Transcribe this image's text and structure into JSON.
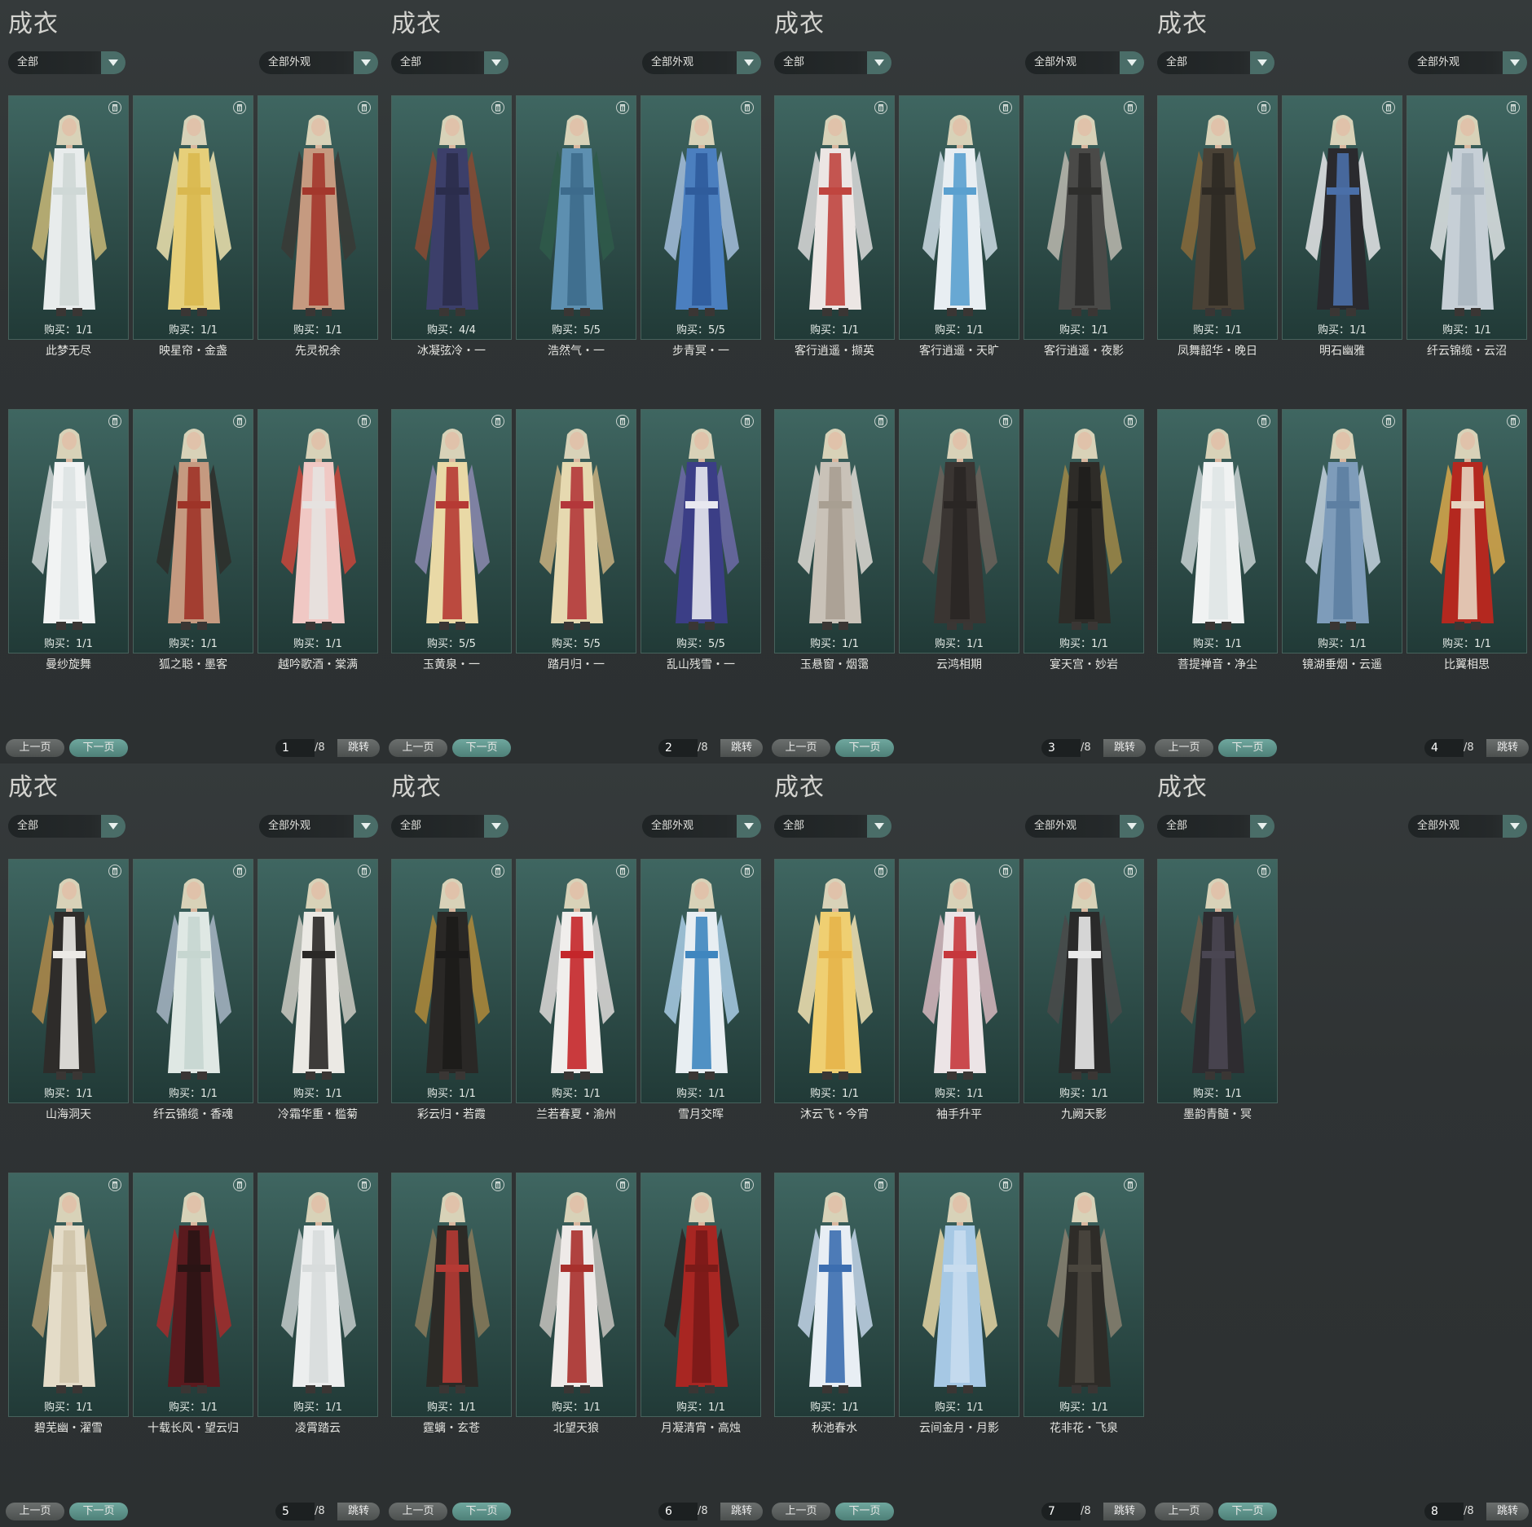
{
  "panels": [
    {
      "title": "成衣",
      "filter1": "全部",
      "filter2": "全部外观",
      "prev": "上一页",
      "next": "下一页",
      "page": "1",
      "total": "/8",
      "jump": "跳转",
      "items": [
        {
          "buy": "购买：1/1",
          "name": "此梦无尽",
          "colors": [
            "#e8ecec",
            "#cfd8d6",
            "#c9b978"
          ]
        },
        {
          "buy": "购买：1/1",
          "name": "映星帘・金盏",
          "colors": [
            "#e6cf7a",
            "#d9b84f",
            "#f0e4b0"
          ]
        },
        {
          "buy": "购买：1/1",
          "name": "先灵祝余",
          "colors": [
            "#c59a80",
            "#a3372c",
            "#3a3a36"
          ]
        },
        {
          "buy": "购买：1/1",
          "name": "曼纱旋舞",
          "colors": [
            "#f1f3f3",
            "#dde3e3",
            "#cfd6d6"
          ]
        },
        {
          "buy": "购买：1/1",
          "name": "狐之聪・墨客",
          "colors": [
            "#c59a80",
            "#9e3428",
            "#2e2e2a"
          ]
        },
        {
          "buy": "购买：1/1",
          "name": "越吟歌酒・棠满",
          "colors": [
            "#f0c8c4",
            "#e6e2e0",
            "#c9453b"
          ]
        }
      ]
    },
    {
      "title": "成衣",
      "filter1": "全部",
      "filter2": "全部外观",
      "prev": "上一页",
      "next": "下一页",
      "page": "2",
      "total": "/8",
      "jump": "跳转",
      "items": [
        {
          "buy": "购买：4/4",
          "name": "冰凝弦冷・一",
          "colors": [
            "#3c3f6a",
            "#2b2d4c",
            "#8a4a32"
          ]
        },
        {
          "buy": "购买：5/5",
          "name": "浩然气・一",
          "colors": [
            "#5d8fb0",
            "#3d6b8c",
            "#2f5b4a"
          ]
        },
        {
          "buy": "购买：5/5",
          "name": "步青冥・一",
          "colors": [
            "#4b7fbf",
            "#2f5c9c",
            "#a6c0de"
          ]
        },
        {
          "buy": "购买：5/5",
          "name": "玉黄泉・一",
          "colors": [
            "#e9d9a6",
            "#b63a34",
            "#8c8ab0"
          ]
        },
        {
          "buy": "购买：5/5",
          "name": "踏月归・一",
          "colors": [
            "#e6d9b0",
            "#b3373a",
            "#c9b080"
          ]
        },
        {
          "buy": "购买：5/5",
          "name": "乱山残雪・一",
          "colors": [
            "#3b3e86",
            "#e8e8f0",
            "#6d6aa8"
          ]
        }
      ]
    },
    {
      "title": "成衣",
      "filter1": "全部",
      "filter2": "全部外观",
      "prev": "上一页",
      "next": "下一页",
      "page": "3",
      "total": "/8",
      "jump": "跳转",
      "items": [
        {
          "buy": "购买：1/1",
          "name": "客行逍遥・撷英",
          "colors": [
            "#ece6e4",
            "#c0453f",
            "#dddcdc"
          ]
        },
        {
          "buy": "购买：1/1",
          "name": "客行逍遥・天旷",
          "colors": [
            "#e8eef2",
            "#5aa0cf",
            "#cfdde6"
          ]
        },
        {
          "buy": "购买：1/1",
          "name": "客行逍遥・夜影",
          "colors": [
            "#4a4a48",
            "#2e2e2c",
            "#bdbab0"
          ]
        },
        {
          "buy": "购买：1/1",
          "name": "玉悬窗・烟霭",
          "colors": [
            "#c9c2b8",
            "#a89f92",
            "#e0dcd6"
          ]
        },
        {
          "buy": "购买：1/1",
          "name": "云鸿相期",
          "colors": [
            "#3a3532",
            "#2a2624",
            "#6b625a"
          ]
        },
        {
          "buy": "购买：1/1",
          "name": "宴天宫・妙岩",
          "colors": [
            "#2e2c28",
            "#1f1e1c",
            "#a08848"
          ]
        }
      ]
    },
    {
      "title": "成衣",
      "filter1": "全部",
      "filter2": "全部外观",
      "prev": "上一页",
      "next": "下一页",
      "page": "4",
      "total": "/8",
      "jump": "跳转",
      "items": [
        {
          "buy": "购买：1/1",
          "name": "凤舞韶华・晚日",
          "colors": [
            "#4a4236",
            "#2e2a24",
            "#8a6a3a"
          ]
        },
        {
          "buy": "购买：1/1",
          "name": "明石幽雅",
          "colors": [
            "#2a2a2e",
            "#4a6fa8",
            "#e8e8ea"
          ]
        },
        {
          "buy": "购买：1/1",
          "name": "纤云锦缆・云沼",
          "colors": [
            "#c6cfd6",
            "#aab6c0",
            "#e2e6e8"
          ]
        },
        {
          "buy": "购买：1/1",
          "name": "菩提禅音・净尘",
          "colors": [
            "#f0f2f2",
            "#dfe5e6",
            "#c9d2d4"
          ]
        },
        {
          "buy": "购买：1/1",
          "name": "镜湖垂烟・云遥",
          "colors": [
            "#7e9cba",
            "#5d7fa2",
            "#c6d4e0"
          ]
        },
        {
          "buy": "购买：1/1",
          "name": "比翼相思",
          "colors": [
            "#b4281f",
            "#e6d4c0",
            "#d9a84a"
          ]
        }
      ]
    },
    {
      "title": "成衣",
      "filter1": "全部",
      "filter2": "全部外观",
      "prev": "上一页",
      "next": "下一页",
      "page": "5",
      "total": "/8",
      "jump": "跳转",
      "items": [
        {
          "buy": "购买：1/1",
          "name": "山海洞天",
          "colors": [
            "#2e2c2a",
            "#eceae6",
            "#b08a4a"
          ]
        },
        {
          "buy": "购买：1/1",
          "name": "纤云锦缆・香魂",
          "colors": [
            "#dfe8e4",
            "#c6d6d0",
            "#a8b6c6"
          ]
        },
        {
          "buy": "购买：1/1",
          "name": "冷霜华重・槛菊",
          "colors": [
            "#ebe9e4",
            "#2a2826",
            "#cfccc4"
          ]
        },
        {
          "buy": "购买：1/1",
          "name": "碧芜幽・濯雪",
          "colors": [
            "#e4dcc8",
            "#cfc4aa",
            "#b09a70"
          ]
        },
        {
          "buy": "购买：1/1",
          "name": "十载长风・望云归",
          "colors": [
            "#5a1a1e",
            "#2a1414",
            "#a62a2a"
          ]
        },
        {
          "buy": "购买：1/1",
          "name": "凌霄踏云",
          "colors": [
            "#eceeee",
            "#d8dcdc",
            "#c6cccc"
          ]
        }
      ]
    },
    {
      "title": "成衣",
      "filter1": "全部",
      "filter2": "全部外观",
      "prev": "上一页",
      "next": "下一页",
      "page": "6",
      "total": "/8",
      "jump": "跳转",
      "items": [
        {
          "buy": "购买：1/1",
          "name": "彩云归・若霞",
          "colors": [
            "#2a2826",
            "#1c1b1a",
            "#b08a3a"
          ]
        },
        {
          "buy": "购买：1/1",
          "name": "兰若春夏・渝州",
          "colors": [
            "#f0eeec",
            "#c4262a",
            "#e0dcda"
          ]
        },
        {
          "buy": "购买：1/1",
          "name": "雪月交晖",
          "colors": [
            "#e8eef2",
            "#3f86bf",
            "#a9cde6"
          ]
        },
        {
          "buy": "购买：1/1",
          "name": "霆螭・玄苍",
          "colors": [
            "#2c2a26",
            "#b53a34",
            "#8a7a5a"
          ]
        },
        {
          "buy": "购买：1/1",
          "name": "北望天狼",
          "colors": [
            "#eeeae8",
            "#a8302c",
            "#c8c4c0"
          ]
        },
        {
          "buy": "购买：1/1",
          "name": "月凝清宵・高烛",
          "colors": [
            "#a82622",
            "#7a1a18",
            "#2a2624"
          ]
        }
      ]
    },
    {
      "title": "成衣",
      "filter1": "全部",
      "filter2": "全部外观",
      "prev": "上一页",
      "next": "下一页",
      "page": "7",
      "total": "/8",
      "jump": "跳转",
      "items": [
        {
          "buy": "购买：1/1",
          "name": "沐云飞・今宵",
          "colors": [
            "#efcf72",
            "#e6b44a",
            "#f4e4b4"
          ]
        },
        {
          "buy": "购买：1/1",
          "name": "袖手升平",
          "colors": [
            "#ece4e6",
            "#c6373c",
            "#d8b8c0"
          ]
        },
        {
          "buy": "购买：1/1",
          "name": "九阙天影",
          "colors": [
            "#2a2a2a",
            "#e8e8e8",
            "#4a4a4a"
          ]
        },
        {
          "buy": "购买：1/1",
          "name": "秋池春水",
          "colors": [
            "#e8eef4",
            "#3c6eb0",
            "#c4d6ea"
          ]
        },
        {
          "buy": "购买：1/1",
          "name": "云间金月・月影",
          "colors": [
            "#a6c8e4",
            "#c8dcee",
            "#e6d6a4"
          ]
        },
        {
          "buy": "购买：1/1",
          "name": "花非花・飞泉",
          "colors": [
            "#2e2c28",
            "#4a463e",
            "#8a8070"
          ]
        }
      ]
    },
    {
      "title": "成衣",
      "filter1": "全部",
      "filter2": "全部外观",
      "prev": "上一页",
      "next": "下一页",
      "page": "8",
      "total": "/8",
      "jump": "跳转",
      "items": [
        {
          "buy": "购买：1/1",
          "name": "墨韵青髓・冥",
          "colors": [
            "#2e2c30",
            "#4a4652",
            "#6a5a4a"
          ]
        }
      ]
    }
  ]
}
